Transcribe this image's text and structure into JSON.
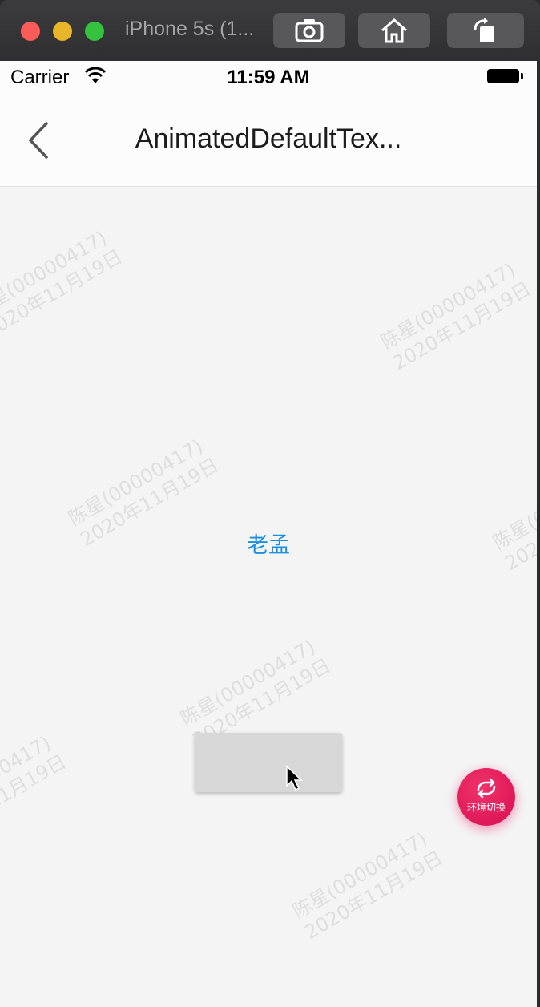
{
  "simulator": {
    "title": "iPhone 5s (1..."
  },
  "statusbar": {
    "carrier": "Carrier",
    "time": "11:59 AM"
  },
  "nav": {
    "title": "AnimatedDefaultTex..."
  },
  "content": {
    "text": "老孟"
  },
  "fab": {
    "label": "环境切换"
  },
  "watermark": {
    "line1": "陈星(00000417)",
    "line2": "2020年11月19日"
  },
  "colors": {
    "accent_text": "#1c8fe2",
    "fab": "#e8185e",
    "button_gray": "#d7d7d7"
  },
  "icons": [
    "screenshot-icon",
    "home-icon",
    "rotate-icon",
    "wifi-icon",
    "battery-icon",
    "back-chevron-icon",
    "switch-icon",
    "mouse-cursor-icon"
  ]
}
